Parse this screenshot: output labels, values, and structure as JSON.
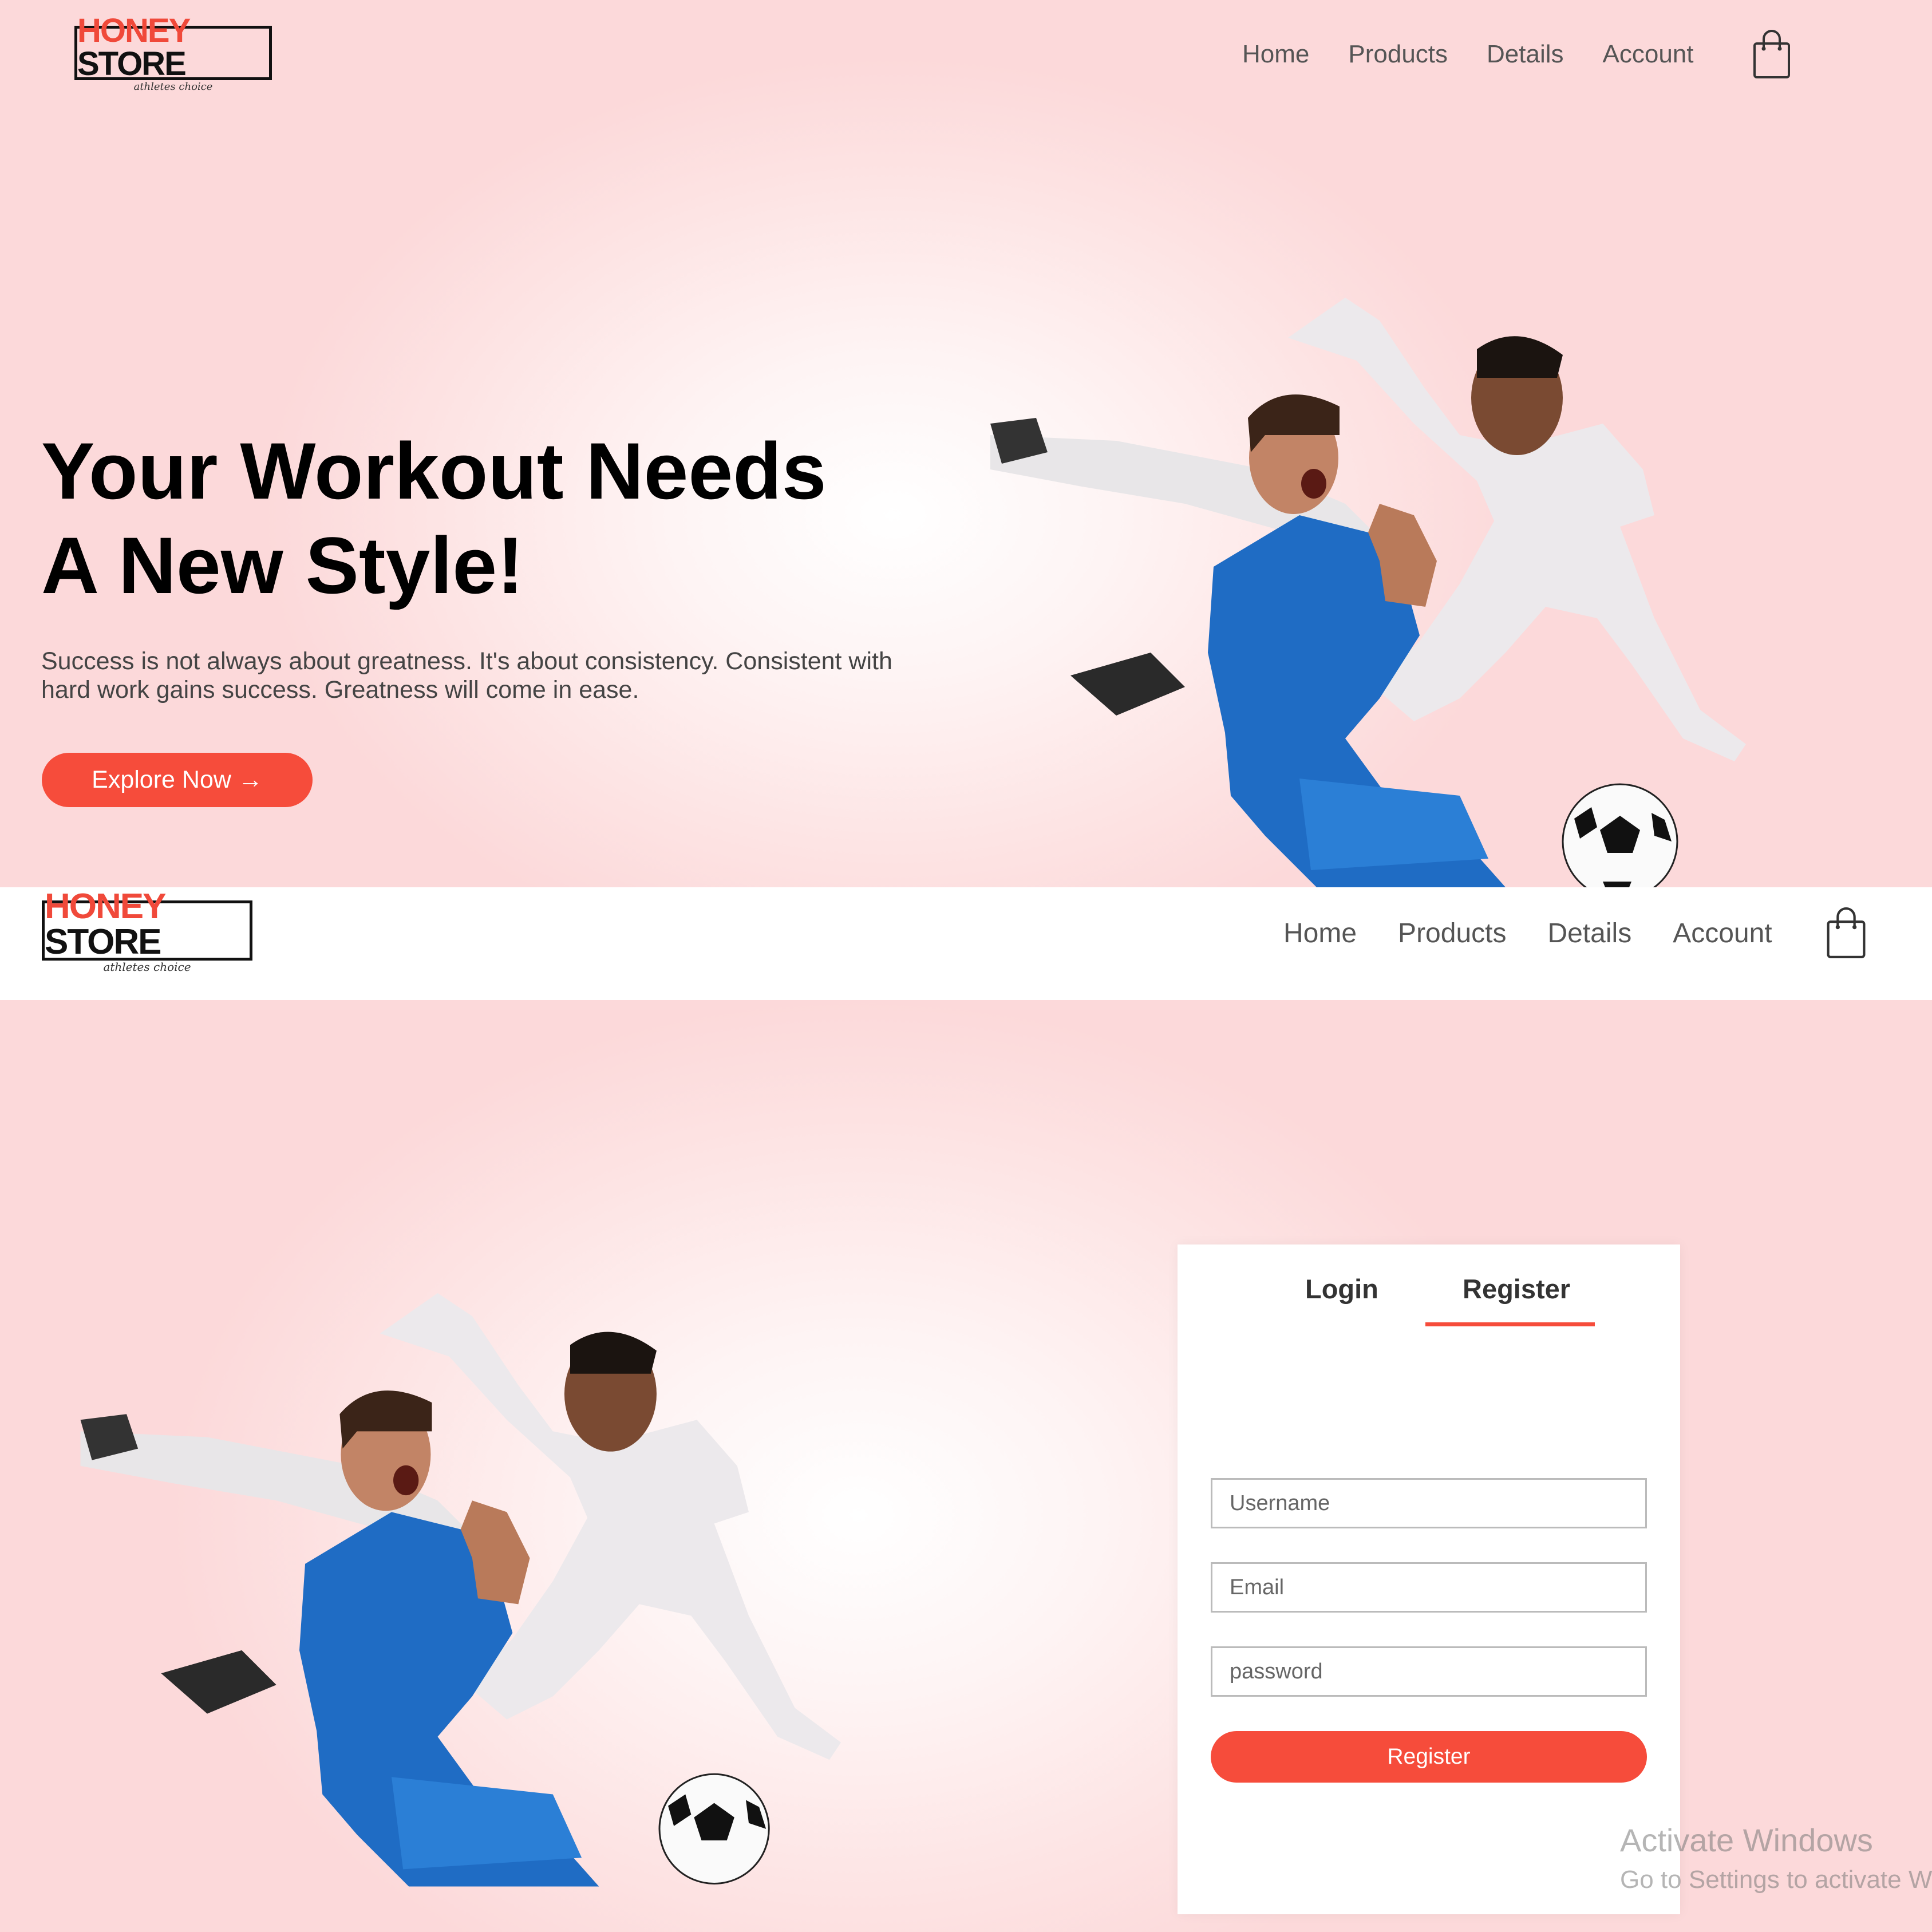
{
  "brand": {
    "name_part1": "HONEY",
    "name_part2": "STORE",
    "tagline": "athletes choice",
    "accent_color": "#f64c3b"
  },
  "nav": {
    "items": [
      {
        "label": "Home"
      },
      {
        "label": "Products"
      },
      {
        "label": "Details"
      },
      {
        "label": "Account"
      }
    ],
    "cart_icon": "shopping-bag-icon"
  },
  "hero": {
    "headline_line1": "Your Workout Needs",
    "headline_line2": "A New Style!",
    "subtext": "Success is not always about greatness. It's about consistency. Consistent with hard work gains success. Greatness will come in ease.",
    "cta_label": "Explore Now →"
  },
  "account_form": {
    "tabs": [
      {
        "label": "Login",
        "active": false
      },
      {
        "label": "Register",
        "active": true
      }
    ],
    "fields": {
      "username_placeholder": "Username",
      "email_placeholder": "Email",
      "password_placeholder": "password"
    },
    "submit_label": "Register"
  },
  "os_watermark": {
    "line1": "Activate Windows",
    "line2": "Go to Settings to activate Windows."
  }
}
